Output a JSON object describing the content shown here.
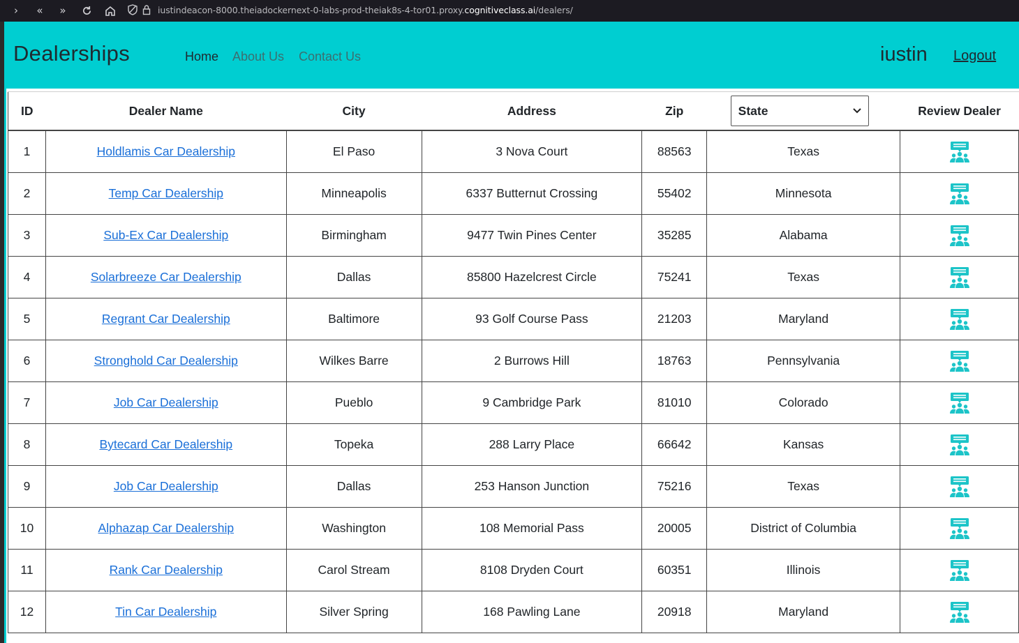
{
  "browser": {
    "url_prefix": "iustindeacon-8000.theiadockernext-0-labs-prod-theiak8s-4-tor01.proxy.",
    "url_domain": "cognitiveclass.ai",
    "url_path": "/dealers/"
  },
  "navbar": {
    "brand": "Dealerships",
    "links": [
      "Home",
      "About Us",
      "Contact Us"
    ],
    "username": "iustin",
    "logout": "Logout",
    "color": "#00ced1"
  },
  "table": {
    "headers": {
      "id": "ID",
      "name": "Dealer Name",
      "city": "City",
      "address": "Address",
      "zip": "Zip",
      "state_select": "State",
      "review": "Review Dealer"
    },
    "rows": [
      {
        "id": "1",
        "name": "Holdlamis Car Dealership",
        "city": "El Paso",
        "address": "3 Nova Court",
        "zip": "88563",
        "state": "Texas"
      },
      {
        "id": "2",
        "name": "Temp Car Dealership",
        "city": "Minneapolis",
        "address": "6337 Butternut Crossing",
        "zip": "55402",
        "state": "Minnesota"
      },
      {
        "id": "3",
        "name": "Sub-Ex Car Dealership",
        "city": "Birmingham",
        "address": "9477 Twin Pines Center",
        "zip": "35285",
        "state": "Alabama"
      },
      {
        "id": "4",
        "name": "Solarbreeze Car Dealership",
        "city": "Dallas",
        "address": "85800 Hazelcrest Circle",
        "zip": "75241",
        "state": "Texas"
      },
      {
        "id": "5",
        "name": "Regrant Car Dealership",
        "city": "Baltimore",
        "address": "93 Golf Course Pass",
        "zip": "21203",
        "state": "Maryland"
      },
      {
        "id": "6",
        "name": "Stronghold Car Dealership",
        "city": "Wilkes Barre",
        "address": "2 Burrows Hill",
        "zip": "18763",
        "state": "Pennsylvania"
      },
      {
        "id": "7",
        "name": "Job Car Dealership",
        "city": "Pueblo",
        "address": "9 Cambridge Park",
        "zip": "81010",
        "state": "Colorado"
      },
      {
        "id": "8",
        "name": "Bytecard Car Dealership",
        "city": "Topeka",
        "address": "288 Larry Place",
        "zip": "66642",
        "state": "Kansas"
      },
      {
        "id": "9",
        "name": "Job Car Dealership",
        "city": "Dallas",
        "address": "253 Hanson Junction",
        "zip": "75216",
        "state": "Texas"
      },
      {
        "id": "10",
        "name": "Alphazap Car Dealership",
        "city": "Washington",
        "address": "108 Memorial Pass",
        "zip": "20005",
        "state": "District of Columbia"
      },
      {
        "id": "11",
        "name": "Rank Car Dealership",
        "city": "Carol Stream",
        "address": "8108 Dryden Court",
        "zip": "60351",
        "state": "Illinois"
      },
      {
        "id": "12",
        "name": "Tin Car Dealership",
        "city": "Silver Spring",
        "address": "168 Pawling Lane",
        "zip": "20918",
        "state": "Maryland"
      }
    ],
    "review_icon": "review-dealer-icon",
    "link_color": "#1a6fd8"
  }
}
